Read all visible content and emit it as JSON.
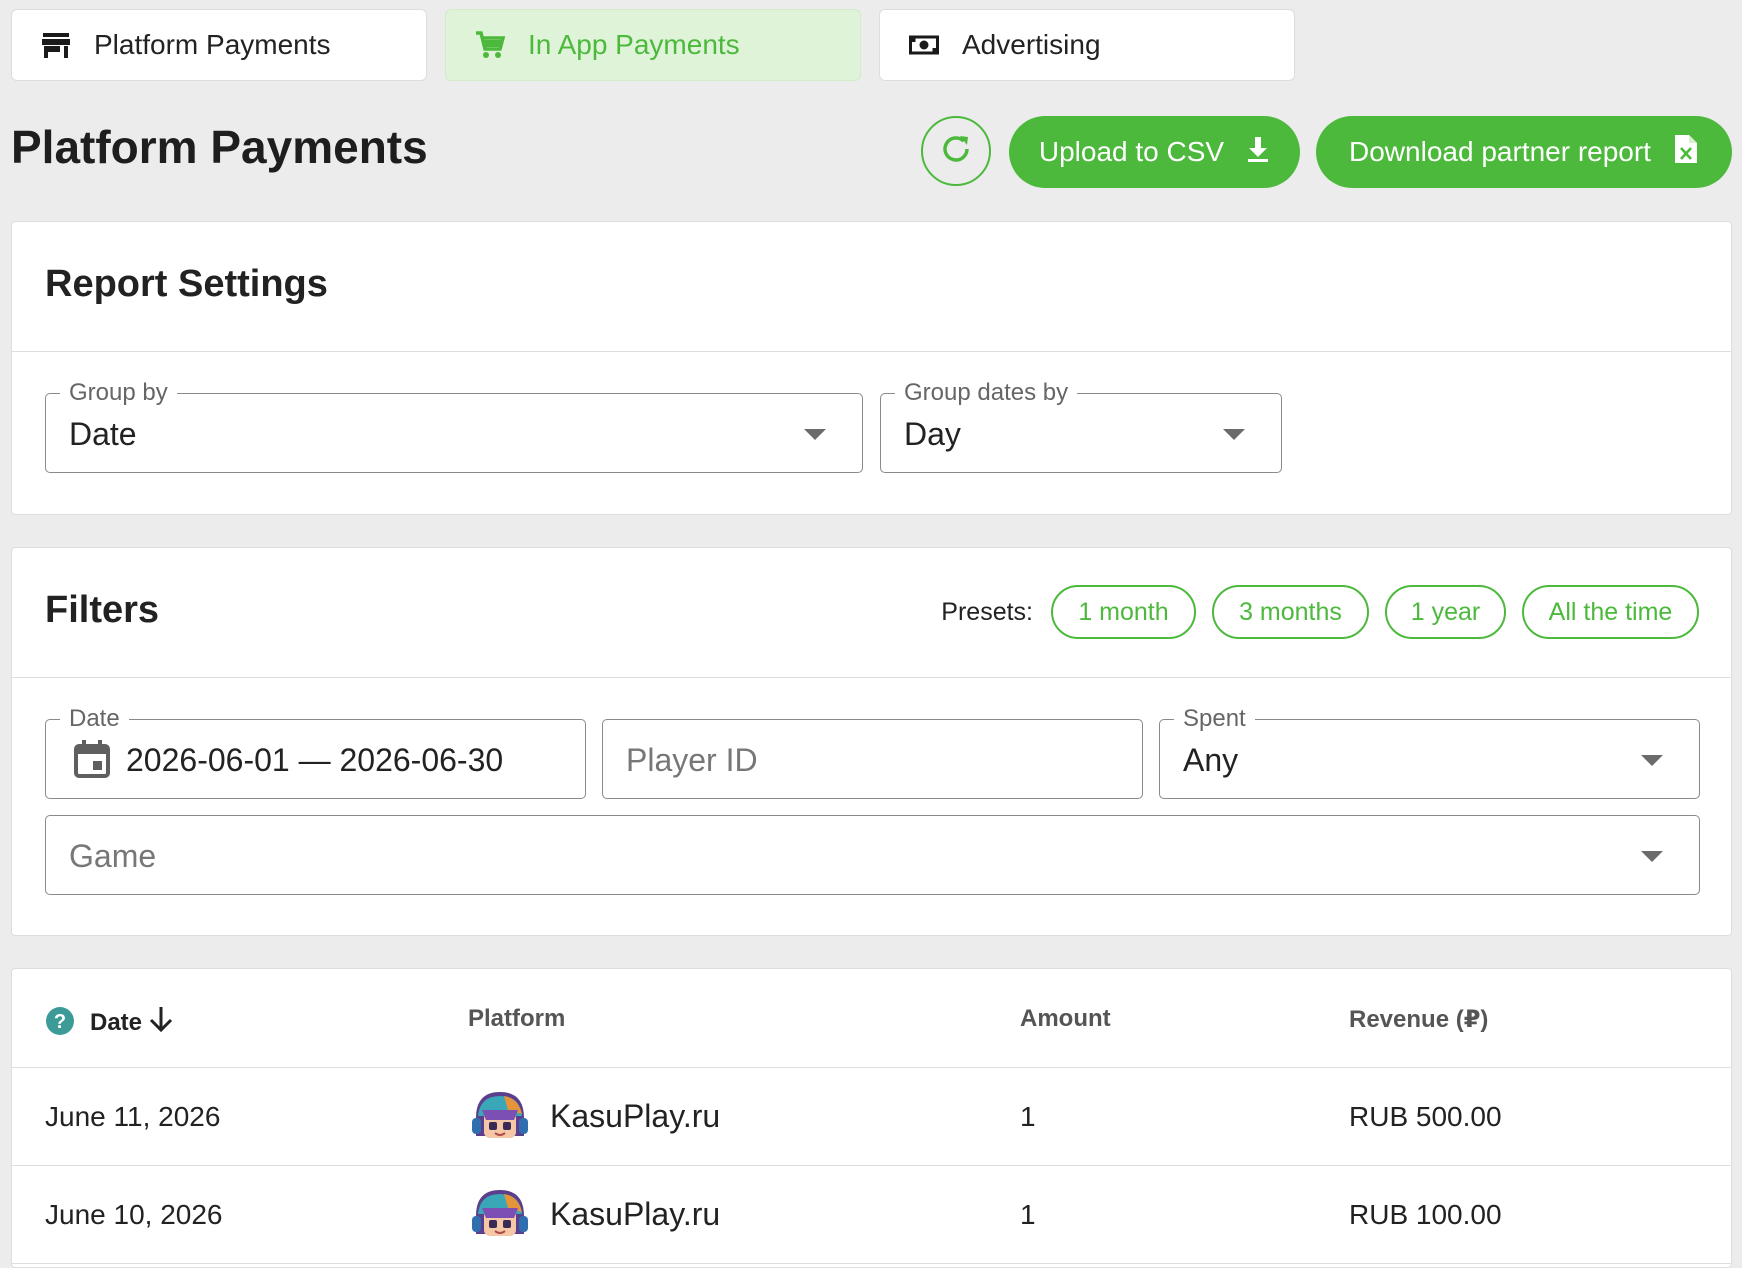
{
  "tabs": [
    {
      "label": "Platform Payments",
      "icon": "store-icon",
      "active": false
    },
    {
      "label": "In App Payments",
      "icon": "cart-icon",
      "active": true
    },
    {
      "label": "Advertising",
      "icon": "cash-icon",
      "active": false
    }
  ],
  "page": {
    "title": "Platform Payments"
  },
  "actions": {
    "refresh_icon": "refresh-icon",
    "upload_label": "Upload to CSV",
    "upload_icon": "download-icon",
    "download_label": "Download partner report",
    "download_icon": "excel-file-icon"
  },
  "report_settings": {
    "title": "Report Settings",
    "group_by": {
      "label": "Group by",
      "value": "Date"
    },
    "group_dates_by": {
      "label": "Group dates by",
      "value": "Day"
    }
  },
  "filters": {
    "title": "Filters",
    "presets_label": "Presets:",
    "presets": [
      "1 month",
      "3 months",
      "1 year",
      "All the time"
    ],
    "date": {
      "label": "Date",
      "value": "2026-06-01 — 2026-06-30"
    },
    "player_id": {
      "placeholder": "Player ID"
    },
    "spent": {
      "label": "Spent",
      "value": "Any"
    },
    "game": {
      "placeholder": "Game"
    }
  },
  "table": {
    "columns": [
      "Date",
      "Platform",
      "Amount",
      "Revenue (₽)"
    ],
    "rows": [
      {
        "date": "June 11, 2026",
        "platform": "KasuPlay.ru",
        "amount": "1",
        "revenue": "RUB 500.00"
      },
      {
        "date": "June 10, 2026",
        "platform": "KasuPlay.ru",
        "amount": "1",
        "revenue": "RUB 100.00"
      }
    ]
  },
  "colors": {
    "accent": "#4cb93c",
    "active_tab_bg": "#dff3d9",
    "background": "#ececec"
  }
}
